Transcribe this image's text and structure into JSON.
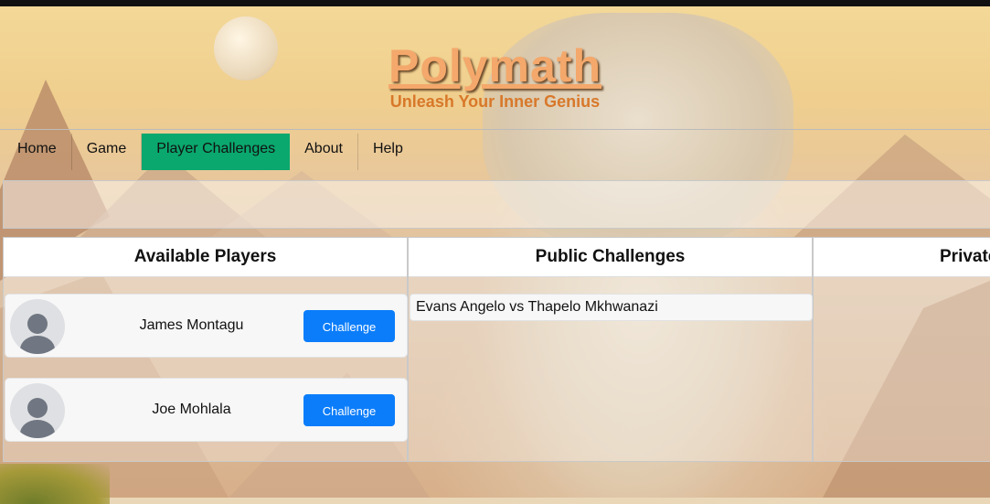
{
  "header": {
    "title": "Polymath",
    "subtitle": "Unleash Your Inner Genius"
  },
  "nav": {
    "items": [
      {
        "label": "Home",
        "active": false
      },
      {
        "label": "Game",
        "active": false
      },
      {
        "label": "Player Challenges",
        "active": true
      },
      {
        "label": "About",
        "active": false
      },
      {
        "label": "Help",
        "active": false
      }
    ]
  },
  "panels": {
    "available_players": {
      "title": "Available Players",
      "players": [
        {
          "name": "James Montagu",
          "button": "Challenge",
          "avatar_icon": "user-avatar-icon"
        },
        {
          "name": "Joe Mohlala",
          "button": "Challenge",
          "avatar_icon": "user-avatar-icon"
        }
      ]
    },
    "public_challenges": {
      "title": "Public Challenges",
      "items": [
        "Evans Angelo vs Thapelo Mkhwanazi"
      ]
    },
    "private_challenges": {
      "title": "Private Challenges"
    }
  },
  "colors": {
    "nav_active": "#0aa86e",
    "button": "#0b7dfa",
    "title": "#f4a86b",
    "subtitle": "#d8782a"
  }
}
